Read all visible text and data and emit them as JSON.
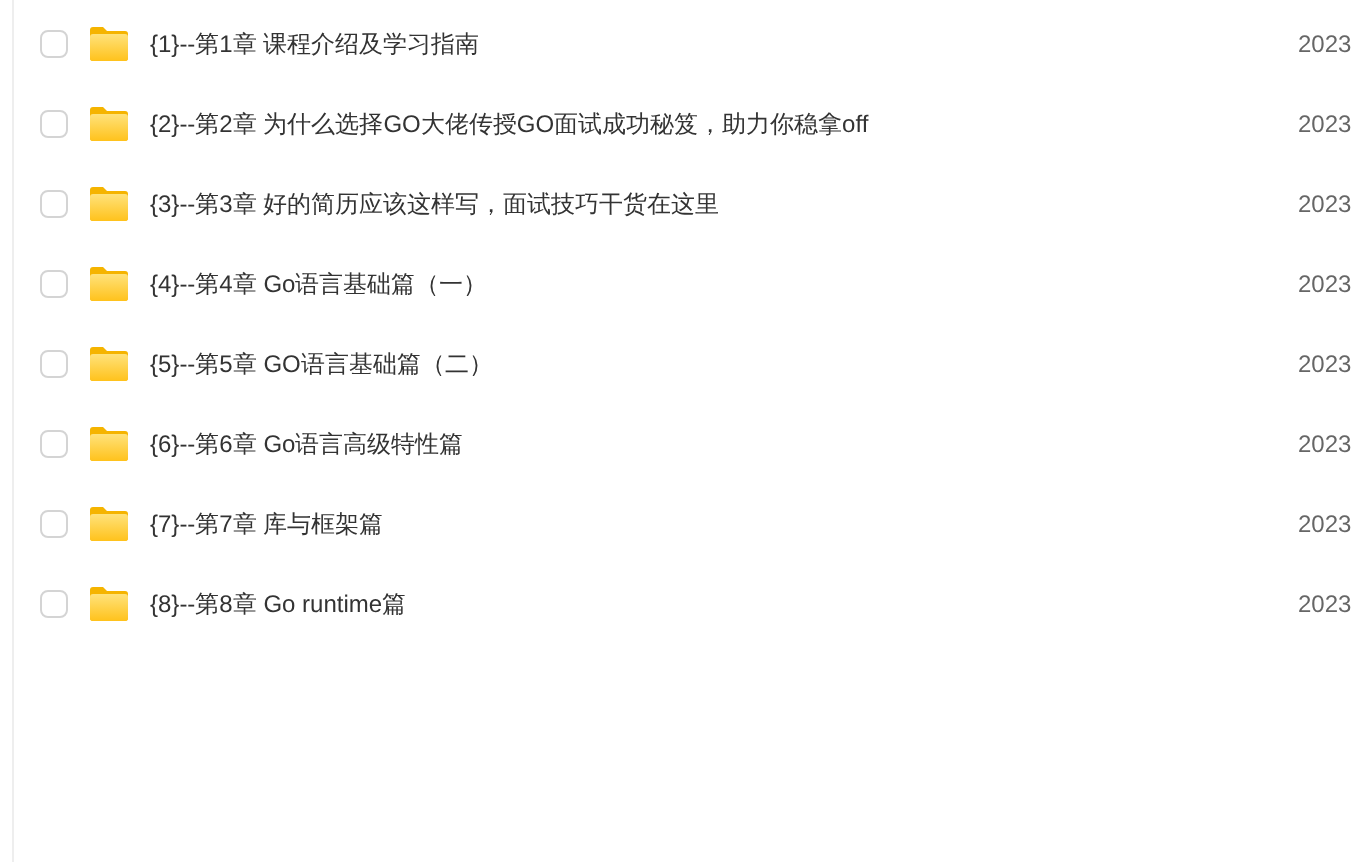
{
  "files": [
    {
      "name": "{1}--第1章 课程介绍及学习指南",
      "date": "2023",
      "checked": false
    },
    {
      "name": "{2}--第2章 为什么选择GO大佬传授GO面试成功秘笈，助力你稳拿off",
      "date": "2023",
      "checked": false
    },
    {
      "name": "{3}--第3章 好的简历应该这样写，面试技巧干货在这里",
      "date": "2023",
      "checked": false
    },
    {
      "name": "{4}--第4章 Go语言基础篇（一）",
      "date": "2023",
      "checked": false
    },
    {
      "name": "{5}--第5章 GO语言基础篇（二）",
      "date": "2023",
      "checked": false
    },
    {
      "name": "{6}--第6章 Go语言高级特性篇",
      "date": "2023",
      "checked": false
    },
    {
      "name": "{7}--第7章 库与框架篇",
      "date": "2023",
      "checked": false
    },
    {
      "name": "{8}--第8章 Go runtime篇",
      "date": "2023",
      "checked": false
    }
  ]
}
